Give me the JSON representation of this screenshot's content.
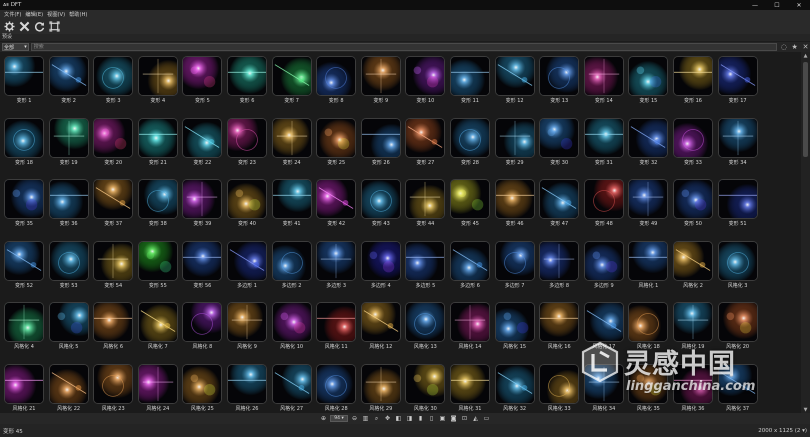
{
  "window": {
    "title": "ᴀᴇ DFT",
    "controls": [
      "—",
      "☐",
      "✕"
    ]
  },
  "menu": [
    "文件(F)",
    "编辑(E)",
    "视图(V)",
    "帮助(H)"
  ],
  "section_label": "预设",
  "filter": {
    "dropdown_value": "全部",
    "search_placeholder": "搜索"
  },
  "tiles": [
    {
      "label": "变形 1",
      "hue": 200
    },
    {
      "label": "变形 2",
      "hue": 210
    },
    {
      "label": "变形 3",
      "hue": 195
    },
    {
      "label": "变形 4",
      "hue": 40
    },
    {
      "label": "变形 5",
      "hue": 300
    },
    {
      "label": "变形 6",
      "hue": 170
    },
    {
      "label": "变形 7",
      "hue": 140
    },
    {
      "label": "变形 8",
      "hue": 220
    },
    {
      "label": "变形 9",
      "hue": 30
    },
    {
      "label": "变形 10",
      "hue": 280
    },
    {
      "label": "变形 11",
      "hue": 205
    },
    {
      "label": "变形 12",
      "hue": 200
    },
    {
      "label": "变形 13",
      "hue": 215
    },
    {
      "label": "变形 14",
      "hue": 320
    },
    {
      "label": "变形 15",
      "hue": 190
    },
    {
      "label": "变形 16",
      "hue": 45
    },
    {
      "label": "变形 17",
      "hue": 230
    },
    {
      "label": "变形 18",
      "hue": 200
    },
    {
      "label": "变形 19",
      "hue": 160
    },
    {
      "label": "变形 20",
      "hue": 310
    },
    {
      "label": "变形 21",
      "hue": 180
    },
    {
      "label": "变形 22",
      "hue": 190
    },
    {
      "label": "变形 23",
      "hue": 320
    },
    {
      "label": "变形 24",
      "hue": 40
    },
    {
      "label": "变形 25",
      "hue": 25
    },
    {
      "label": "变形 26",
      "hue": 210
    },
    {
      "label": "变形 27",
      "hue": 20
    },
    {
      "label": "变形 28",
      "hue": 205
    },
    {
      "label": "变形 29",
      "hue": 200
    },
    {
      "label": "变形 30",
      "hue": 210
    },
    {
      "label": "变形 31",
      "hue": 195
    },
    {
      "label": "变形 32",
      "hue": 220
    },
    {
      "label": "变形 33",
      "hue": 290
    },
    {
      "label": "变形 34",
      "hue": 205
    },
    {
      "label": "变形 35",
      "hue": 215
    },
    {
      "label": "变形 36",
      "hue": 205
    },
    {
      "label": "变形 37",
      "hue": 35
    },
    {
      "label": "变形 38",
      "hue": 200
    },
    {
      "label": "变形 39",
      "hue": 290
    },
    {
      "label": "变形 40",
      "hue": 40
    },
    {
      "label": "变形 41",
      "hue": 195
    },
    {
      "label": "变形 42",
      "hue": 300
    },
    {
      "label": "变形 43",
      "hue": 200
    },
    {
      "label": "变形 44",
      "hue": 45
    },
    {
      "label": "变形 45",
      "hue": 60
    },
    {
      "label": "变形 46",
      "hue": 35
    },
    {
      "label": "变形 47",
      "hue": 205
    },
    {
      "label": "变形 48",
      "hue": 0
    },
    {
      "label": "变形 49",
      "hue": 220
    },
    {
      "label": "变形 50",
      "hue": 220
    },
    {
      "label": "变形 51",
      "hue": 230
    },
    {
      "label": "变形 52",
      "hue": 210
    },
    {
      "label": "变形 53",
      "hue": 200
    },
    {
      "label": "变形 54",
      "hue": 45
    },
    {
      "label": "变形 55",
      "hue": 120
    },
    {
      "label": "变形 56",
      "hue": 220
    },
    {
      "label": "多边形 1",
      "hue": 230
    },
    {
      "label": "多边形 2",
      "hue": 210
    },
    {
      "label": "多边形 3",
      "hue": 215
    },
    {
      "label": "多边形 4",
      "hue": 240
    },
    {
      "label": "多边形 5",
      "hue": 220
    },
    {
      "label": "多边形 6",
      "hue": 210
    },
    {
      "label": "多边形 7",
      "hue": 215
    },
    {
      "label": "多边形 8",
      "hue": 225
    },
    {
      "label": "多边形 9",
      "hue": 220
    },
    {
      "label": "风格化 1",
      "hue": 215
    },
    {
      "label": "风格化 2",
      "hue": 40
    },
    {
      "label": "风格化 3",
      "hue": 200
    },
    {
      "label": "风格化 4",
      "hue": 150
    },
    {
      "label": "风格化 5",
      "hue": 200
    },
    {
      "label": "风格化 6",
      "hue": 30
    },
    {
      "label": "风格化 7",
      "hue": 45
    },
    {
      "label": "风格化 8",
      "hue": 280
    },
    {
      "label": "风格化 9",
      "hue": 35
    },
    {
      "label": "风格化 10",
      "hue": 290
    },
    {
      "label": "风格化 11",
      "hue": 0
    },
    {
      "label": "风格化 12",
      "hue": 40
    },
    {
      "label": "风格化 13",
      "hue": 210
    },
    {
      "label": "风格化 14",
      "hue": 320
    },
    {
      "label": "风格化 15",
      "hue": 210
    },
    {
      "label": "风格化 16",
      "hue": 35
    },
    {
      "label": "风格化 17",
      "hue": 210
    },
    {
      "label": "风格化 18",
      "hue": 30
    },
    {
      "label": "风格化 19",
      "hue": 200
    },
    {
      "label": "风格化 20",
      "hue": 20
    },
    {
      "label": "风格化 21",
      "hue": 300
    },
    {
      "label": "风格化 22",
      "hue": 30
    },
    {
      "label": "风格化 23",
      "hue": 30
    },
    {
      "label": "风格化 24",
      "hue": 300
    },
    {
      "label": "风格化 25",
      "hue": 35
    },
    {
      "label": "风格化 26",
      "hue": 200
    },
    {
      "label": "风格化 27",
      "hue": 200
    },
    {
      "label": "风格化 28",
      "hue": 215
    },
    {
      "label": "风格化 29",
      "hue": 35
    },
    {
      "label": "风格化 30",
      "hue": 45
    },
    {
      "label": "风格化 31",
      "hue": 45
    },
    {
      "label": "风格化 32",
      "hue": 200
    },
    {
      "label": "风格化 33",
      "hue": 40
    },
    {
      "label": "风格化 34",
      "hue": 210
    },
    {
      "label": "风格化 35",
      "hue": 30
    },
    {
      "label": "风格化 36",
      "hue": 320
    },
    {
      "label": "风格化 37",
      "hue": 210
    }
  ],
  "bottombar": {
    "zoom_value": "94 ▾"
  },
  "status": {
    "left": "变形 45",
    "right": "2000 x 1125 (2 ▾)"
  },
  "watermark": {
    "cn": "灵感中国",
    "url": "lingganchina.com"
  },
  "colors": {
    "accent": "#4aa3ff",
    "background": "#1b1b1b"
  }
}
